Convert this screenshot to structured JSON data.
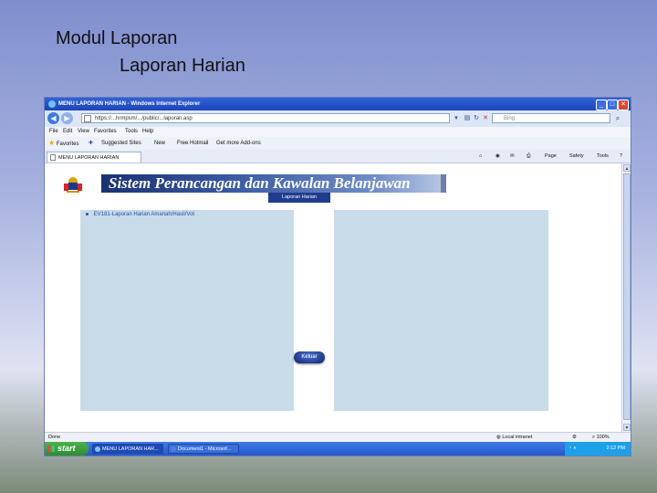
{
  "slide": {
    "title": "Modul Laporan",
    "subtitle": "Laporan Harian"
  },
  "window": {
    "title": "MENU LAPORAN HARIAN - Windows Internet Explorer"
  },
  "address": {
    "url": "https://...hrmpsm/.../public/...laporan.asp",
    "search_placeholder": "Bing"
  },
  "menu": [
    "File",
    "Edit",
    "View",
    "Favorites",
    "Tools",
    "Help"
  ],
  "favorites": {
    "label": "Favorites",
    "items": [
      "Suggested Sites",
      "New",
      "Free Hotmail",
      "Get more Add-ons"
    ]
  },
  "tab": {
    "label": "MENU LAPORAN HARIAN"
  },
  "commands": [
    "Page",
    "Safety",
    "Tools"
  ],
  "page": {
    "banner": "Sistem Perancangan dan Kawalan Belanjawan",
    "subtab": "Laporan Harian",
    "link": "EV181-Laporan Harian Amanah/Hasil/Vot",
    "exit_button": "Keluar"
  },
  "status": {
    "left": "Done",
    "zone": "Local intranet",
    "zoom": "100%"
  },
  "taskbar": {
    "start": "start",
    "tasks": [
      "MENU LAPORAN HAR...",
      "Document1 - Microsof..."
    ],
    "clock": "2:12 PM"
  }
}
